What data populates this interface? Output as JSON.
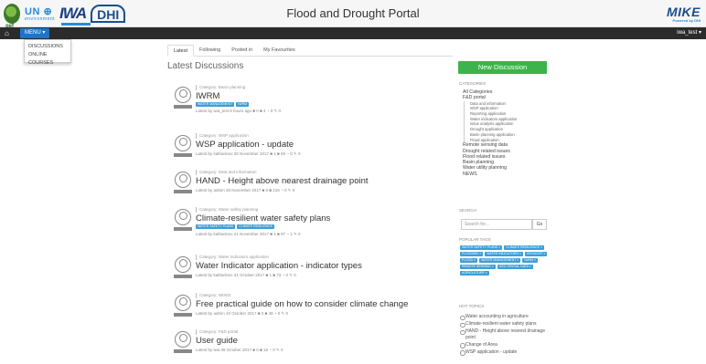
{
  "header": {
    "title": "Flood and Drought Portal",
    "logos": {
      "gef": "gef",
      "un": "UN",
      "un_sub": "environment",
      "iwa": "IWA",
      "dhi": "DHI",
      "mike": "MIKE",
      "mike_sub": "Powered by DHI"
    }
  },
  "nav": {
    "menu_label": "MENU ▾",
    "user_label": "iwa_test ▾",
    "menu_items": [
      "DISCUSSIONS",
      "ONLINE COURSES"
    ]
  },
  "tabs": [
    "Latest",
    "Following",
    "Posted in",
    "My Favourites"
  ],
  "page_heading": "Latest Discussions",
  "discussions": [
    {
      "category": "Category: Basin planning",
      "title": "IWRM",
      "tags": [
        "WATER MANAGEMENT",
        "IWRM"
      ],
      "meta": "Latest by iwa_test 8 hours ago  ■ 0  ■ 4  ◔ 0  ✎ 0"
    },
    {
      "category": "Category: WSP application",
      "title": "WSP application - update",
      "tags": [],
      "meta": "Latest by katharineo 28 November 2017  ■ 1  ■ 59  ◔ 0  ✎ 0"
    },
    {
      "category": "Category: Data and information",
      "title": "HAND - Height above nearest drainage point",
      "tags": [],
      "meta": "Latest by admin 28 November 2017  ■ 0  ■ 216  ◔ 0  ✎ 0"
    },
    {
      "category": "Category: Water safety planning",
      "title": "Climate-resilient water safety plans",
      "tags": [
        "WATER SAFETY PLANS",
        "CLIMATE RESILIENCE"
      ],
      "meta": "Latest by katharineo 21 November 2017  ■ 1  ■ 97  ◔ 1  ✎ 0"
    },
    {
      "category": "Category: Water indicators application",
      "title": "Water Indicator application - indicator types",
      "tags": [],
      "meta": "Latest by katharineo 31 October 2017  ■ 1  ■ 73  ◔ 0  ✎ 0"
    },
    {
      "category": "Category: NEWS",
      "title": "Free practical guide on how to consider climate change",
      "tags": [],
      "meta": "Latest by admin 10 October 2017  ■ 0  ■ 49  ◔ 0  ✎ 0"
    },
    {
      "category": "Category: F&D portal",
      "title": "User guide",
      "tags": [],
      "meta": "Latest by iwa 06 October 2017  ■ 0  ■ 18  ◔ 0  ✎ 0"
    }
  ],
  "sidebar": {
    "new_discussion": "New Discussion",
    "categories_heading": "CATEGORIES",
    "categories_top": [
      "All Categories",
      "F&D portal"
    ],
    "categories_sub": [
      "Data and information",
      "WSP application",
      "Reporting application",
      "Water indicators application",
      "Issue analysis application",
      "Drought application",
      "Basin planning application",
      "Flood application"
    ],
    "categories_rest": [
      "Remote sensing data",
      "Drought related issues",
      "Flood related issues",
      "Basin planning",
      "Water utility planning",
      "NEWS"
    ],
    "search_heading": "SEARCH",
    "search_placeholder": "Search for...",
    "search_button": "Go",
    "popular_tags_heading": "POPULAR TAGS",
    "popular_tags": [
      "WATER SAFETY PLANS ×",
      "CLIMATE RESILIENCE ×",
      "FLOODING ×",
      "WATER INDICATORS ×",
      "DROUGHT ×",
      "FLOOD ×",
      "WATER MANAGEMENT ×",
      "IWRM ×",
      "REMOTE SENSING ×",
      "GEO SPATIAL DATA ×",
      "AGRICULTURE ×"
    ],
    "hot_topics_heading": "HOT TOPICS",
    "hot_topics": [
      "Water accounting in agriculture",
      "Climate-resilient water safety plans",
      "HAND - Height above nearest drainage point",
      "Change of Area",
      "WSP application - update"
    ]
  }
}
